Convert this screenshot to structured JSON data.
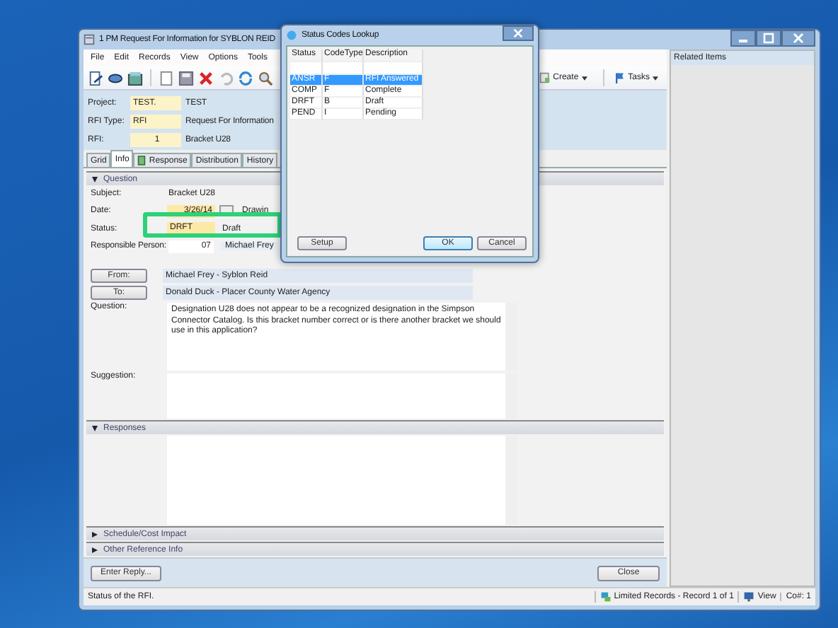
{
  "window": {
    "title": "1 PM Request For Information for SYBLON REID"
  },
  "menu": [
    "File",
    "Edit",
    "Records",
    "View",
    "Options",
    "Tools"
  ],
  "toolbar": {
    "menus": [
      {
        "label": "Create",
        "kind": "create"
      },
      {
        "label": "Tasks",
        "kind": "tasks"
      }
    ]
  },
  "header": [
    {
      "label": "Project:",
      "code": "TEST.",
      "description": "TEST"
    },
    {
      "label": "RFI Type:",
      "code": "RFI",
      "description": "Request For Information"
    },
    {
      "label": "RFI:",
      "code": "1",
      "description": "Bracket U28"
    }
  ],
  "tabs": [
    {
      "label": "Grid",
      "selected": false
    },
    {
      "label": "Info",
      "selected": true
    },
    {
      "label": "Response",
      "selected": false
    },
    {
      "label": "Distribution",
      "selected": false
    },
    {
      "label": "History",
      "selected": false
    }
  ],
  "question": {
    "title": "Question",
    "expanded": true,
    "subject": {
      "label": "Subject:",
      "value": "Bracket U28"
    },
    "date": {
      "label": "Date:",
      "value": "3/26/14",
      "extra_label": "Drawin"
    },
    "status": {
      "label": "Status:",
      "code": "DRFT",
      "description": "Draft",
      "highlighted": true
    },
    "responsible": {
      "label": "Responsible Person:",
      "code": "07",
      "name": "Michael Frey"
    },
    "from": {
      "button": "From:",
      "value": "Michael Frey - Syblon Reid"
    },
    "to": {
      "button": "To:",
      "value": "Donald Duck - Placer County Water Agency"
    },
    "question_text": {
      "label": "Question:",
      "value": "Designation U28 does not appear to be a recognized designation in the Simpson Connector Catalog.  Is this bracket number correct or is there another bracket we should use in this application?"
    },
    "suggestion": {
      "label": "Suggestion:"
    }
  },
  "responses": {
    "title": "Responses",
    "expanded": true
  },
  "sections": [
    {
      "title": "Schedule/Cost Impact",
      "expanded": false
    },
    {
      "title": "Other Reference Info",
      "expanded": false
    }
  ],
  "buttons": {
    "enter_reply": "Enter Reply...",
    "close": "Close"
  },
  "related_items": {
    "title": "Related Items"
  },
  "status_bar": {
    "message": "Status of the RFI.",
    "records": "Limited Records - Record 1 of 1",
    "mode": "View",
    "count": "Co#: 1"
  },
  "dialog": {
    "title": "Status Codes Lookup",
    "columns": [
      "Status",
      "CodeType",
      "Description"
    ],
    "rows": [
      {
        "cells": [
          "ANSR",
          "F",
          "RFI Answered"
        ],
        "selected": true
      },
      {
        "cells": [
          "COMP",
          "F",
          "Complete"
        ],
        "selected": false
      },
      {
        "cells": [
          "DRFT",
          "B",
          "Draft"
        ],
        "selected": false
      },
      {
        "cells": [
          "PEND",
          "I",
          "Pending"
        ],
        "selected": false
      }
    ],
    "buttons": [
      {
        "label": "Setup",
        "kind": "setup"
      },
      {
        "label": "OK",
        "kind": "default"
      },
      {
        "label": "Cancel",
        "kind": "cancel"
      }
    ]
  }
}
